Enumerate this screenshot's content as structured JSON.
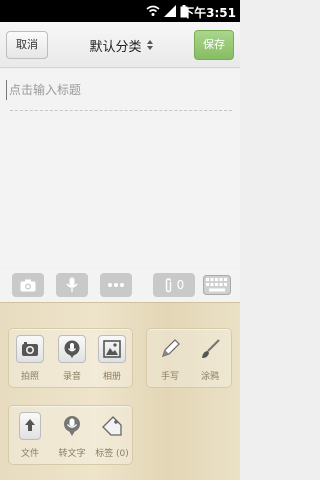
{
  "status_bar": {
    "time": "下午3:51"
  },
  "header": {
    "cancel_label": "取消",
    "category_label": "默认分类",
    "save_label": "保存"
  },
  "editor": {
    "title_placeholder": "点击输入标题"
  },
  "toolbar": {
    "attachment_count": "0"
  },
  "panel": {
    "group1": [
      {
        "label": "拍照",
        "icon": "camera-icon"
      },
      {
        "label": "录音",
        "icon": "microphone-icon"
      },
      {
        "label": "相册",
        "icon": "photo-album-icon"
      }
    ],
    "group2": [
      {
        "label": "手写",
        "icon": "pencil-icon"
      },
      {
        "label": "涂鸦",
        "icon": "paintbrush-icon"
      }
    ],
    "group3": [
      {
        "label": "文件",
        "icon": "file-upload-icon"
      },
      {
        "label": "转文字",
        "icon": "speech-to-text-icon"
      },
      {
        "label": "标签 (0)",
        "icon": "tag-icon"
      }
    ]
  },
  "colors": {
    "accent": "#86bd62",
    "panel_bg": "#eee4ca",
    "label": "#8a7d60"
  }
}
